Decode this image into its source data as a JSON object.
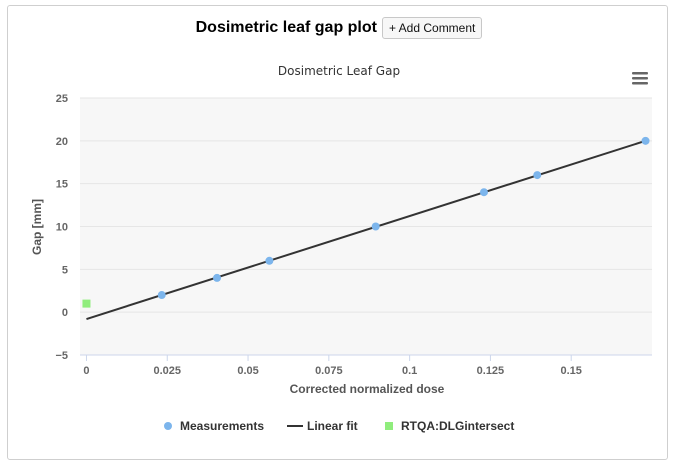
{
  "header": {
    "title": "Dosimetric leaf gap plot",
    "add_comment_label": "+ Add Comment"
  },
  "chart_menu": {
    "icon": "hamburger-menu-icon"
  },
  "colors": {
    "measurements": "#7cb5ec",
    "linear_fit": "#333333",
    "intersect": "#90ed7d",
    "plot_background": "#f7f7f7",
    "grid": "#e6e6e6"
  },
  "chart_data": {
    "type": "scatter",
    "title": "Dosimetric Leaf Gap",
    "xlabel": "Corrected normalized dose",
    "ylabel": "Gap [mm]",
    "xlim": [
      -0.002,
      0.175
    ],
    "ylim": [
      -5,
      25
    ],
    "x_ticks": [
      0,
      0.025,
      0.05,
      0.075,
      0.1,
      0.125,
      0.15
    ],
    "x_tick_labels": [
      "0",
      "0.025",
      "0.05",
      "0.075",
      "0.1",
      "0.125",
      "0.15"
    ],
    "y_ticks": [
      -5,
      0,
      5,
      10,
      15,
      20,
      25
    ],
    "y_tick_labels": [
      "−5",
      "0",
      "5",
      "10",
      "15",
      "20",
      "25"
    ],
    "grid": true,
    "legend_position": "bottom",
    "series": [
      {
        "name": "Measurements",
        "kind": "scatter",
        "x": [
          0.0233,
          0.0404,
          0.0566,
          0.0895,
          0.123,
          0.1395,
          0.173
        ],
        "y": [
          2,
          4,
          6,
          10,
          14,
          16,
          20
        ]
      },
      {
        "name": "Linear fit",
        "kind": "line",
        "x": [
          0,
          0.173
        ],
        "y": [
          -0.8,
          20
        ]
      },
      {
        "name": "RTQA:DLGintersect",
        "kind": "square",
        "x": [
          0
        ],
        "y": [
          1
        ]
      }
    ]
  }
}
